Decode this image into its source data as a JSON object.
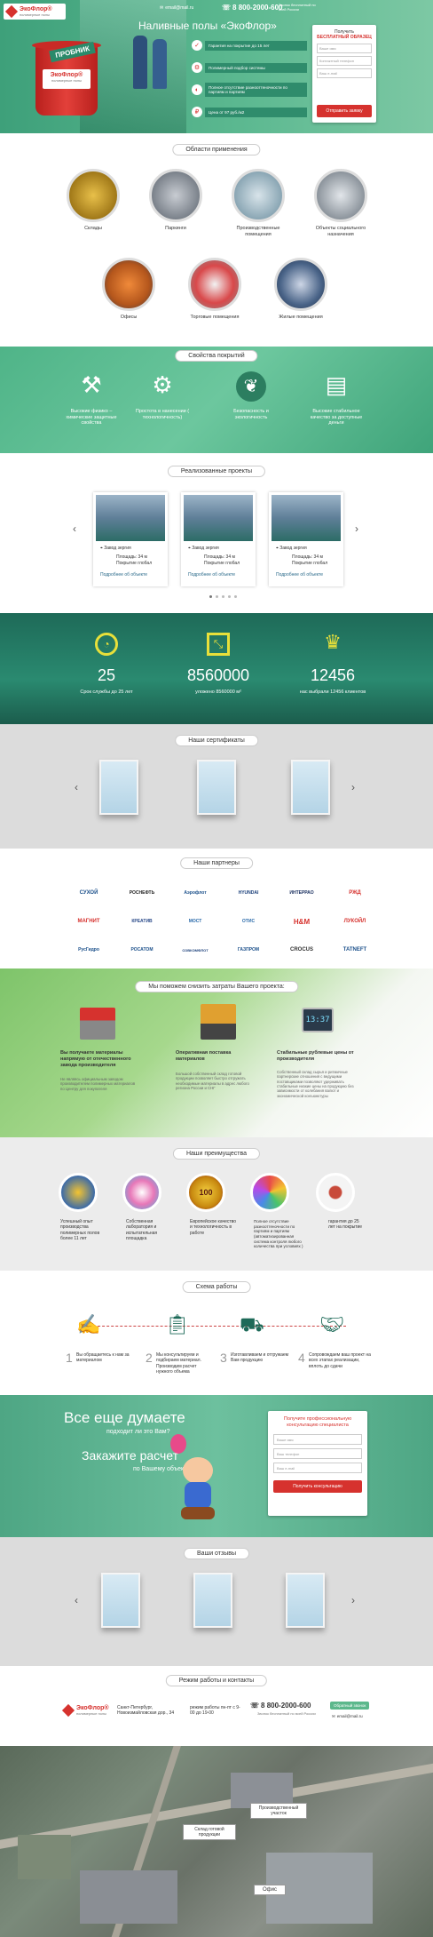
{
  "header": {
    "logo_name": "ЭкоФлор®",
    "logo_sub": "полимерные полы",
    "email": "email@mail.ru",
    "phone": "8 800-2000-600",
    "phone_note": "Звонок бесплатный по всей России",
    "title": "Наливные полы «ЭкоФлор»",
    "badge": "ПРОБНИК",
    "bucket_label": "ЭкоФлор®",
    "bucket_sub": "полимерные полы",
    "features": [
      "Гарантия на покрытие до 15 лет",
      "Полимерный подбор системы",
      "Полное отсутствие разнооттеночности по партиям и партиям",
      "Цена от 97 руб./м2"
    ],
    "form": {
      "title": "Получить",
      "title_accent": "БЕСПЛАТНЫЙ ОБРАЗЕЦ",
      "fields": [
        "Ваше имя",
        "Контактный телефон",
        "Ваш e-mail"
      ],
      "button": "Отправить заявку"
    }
  },
  "areas": {
    "title": "Области применения",
    "items": [
      "Склады",
      "Паркинги",
      "Производственные помещения",
      "Объекты социального назначения",
      "Офисы",
      "Торговые помещения",
      "Жилые помещения"
    ]
  },
  "properties": {
    "title": "Свойства покрытий",
    "items": [
      "Высокие физико – химические защитные свойства",
      "Простота в нанесении ( технологичность)",
      "Безопасность и экологичность",
      "Высокие стабильное качество за доступные деньги"
    ]
  },
  "projects": {
    "title": "Реализованные проекты",
    "cards": [
      {
        "name": "Завод зергия",
        "area": "Площадь: 34 м",
        "note": "Покрытие глобал",
        "link": "Подробнее об объекте"
      },
      {
        "name": "Завод зергия",
        "area": "Площадь: 34 м",
        "note": "Покрытие глобал",
        "link": "Подробнее об объекте"
      },
      {
        "name": "Завод зергия",
        "area": "Площадь: 34 м",
        "note": "Покрытие глобал",
        "link": "Подробнее об объекте"
      }
    ]
  },
  "stats": [
    {
      "value": "25",
      "label": "Срок службы до 25 лет"
    },
    {
      "value": "8560000",
      "label": "уложено 8560000 м²"
    },
    {
      "value": "12456",
      "label": "нас выбрали 12456 клиентов"
    }
  ],
  "certificates": {
    "title": "Наши сертификаты"
  },
  "partners": {
    "title": "Наши партнеры",
    "logos": [
      "СУХОЙ",
      "РОСНЕФТЬ",
      "Аэрофлот",
      "HYUNDAI",
      "ИНТЕРРАО",
      "РЖД",
      "МАГНИТ",
      "КРЕАТИВ",
      "МОСТ",
      "ОТИС",
      "H&M",
      "ЛУКОЙЛ",
      "РусГидро",
      "РОСАТОМ",
      "СОВКОМФЛОТ",
      "ГАЗПРОМ",
      "CROCUS",
      "TATNEFT"
    ]
  },
  "savings": {
    "title": "Мы поможем снизить затраты Вашего проекта:",
    "items": [
      {
        "head": "Вы получаете материалы напрямую от отечественного завода производителя",
        "body": "Не являясь официальным заводом производителем полимерных материалов по Центру для покупателя"
      },
      {
        "head": "Оперативная поставка материалов",
        "body": "Большой собственный склад готовой продукции позволяет быстро отгружать необходимые материалы в адрес любого региона России и СНГ"
      },
      {
        "head": "Стабильные рублевые цены от производителя",
        "body": "Собственный склад сырья и ритмичные партнерские отношения с ведущими поставщиками позволяют удерживать стабильные низкие цены на продукцию без зависимости от колебания валют и экономической конъюнктуры"
      }
    ],
    "display": "13:37"
  },
  "advantages": {
    "title": "Наши преимущества",
    "badge": "100",
    "items": [
      "Успешный опыт производства полимерных полов более 11 лет",
      "Собственная лаборатория и испытательная площадка",
      "Европейское качество и технологичность в работе",
      "Полное отсутствие разнооттеночности по партиям и партиям (автоматизированная система контроля любого количества при условиях )",
      "гарантия до 25 лет на покрытие"
    ]
  },
  "scheme": {
    "title": "Схема работы",
    "steps": [
      {
        "n": "1",
        "text": "Вы обращаетесь к нам за материалом"
      },
      {
        "n": "2",
        "text": "Мы консультируем и подбираем материал. Производим расчет нужного объема"
      },
      {
        "n": "3",
        "text": "Изготавливаем и отгружаем Вам продукцию"
      },
      {
        "n": "4",
        "text": "Сопровождаем ваш проект на всех этапах реализации, вплоть до сдачи"
      }
    ]
  },
  "cta": {
    "line1": "Все еще думаете",
    "line2": "подходит ли это Вам?",
    "line3": "Закажите расчет",
    "line4": "по Вашему объекту",
    "form_title": "Получите профессиональную консультацию специалиста",
    "fields": [
      "Ваше имя",
      "Ваш телефон",
      "Ваш e-mail"
    ],
    "button": "Получить консультацию"
  },
  "reviews": {
    "title": "Ваши отзывы"
  },
  "contacts": {
    "title": "Режим работы и контакты",
    "logo_name": "ЭкоФлор®",
    "logo_sub": "полимерные полы",
    "address": "Санкт-Петербург, Новоизмайловская дор., 34",
    "hours": "режим работы пн-пт с 9-00 до 19-00",
    "phone": "8 800-2000-600",
    "phone_note": "Звонок бесплатный по всей России",
    "callback": "Обратный звонок",
    "email": "email@mail.ru"
  },
  "map": {
    "labels": [
      "Склад готовой продукции",
      "Производственный участок",
      "Офис"
    ]
  },
  "colors": {
    "accent": "#2a8a6a",
    "red": "#d6322e",
    "teal_dark": "#1b6b58"
  }
}
